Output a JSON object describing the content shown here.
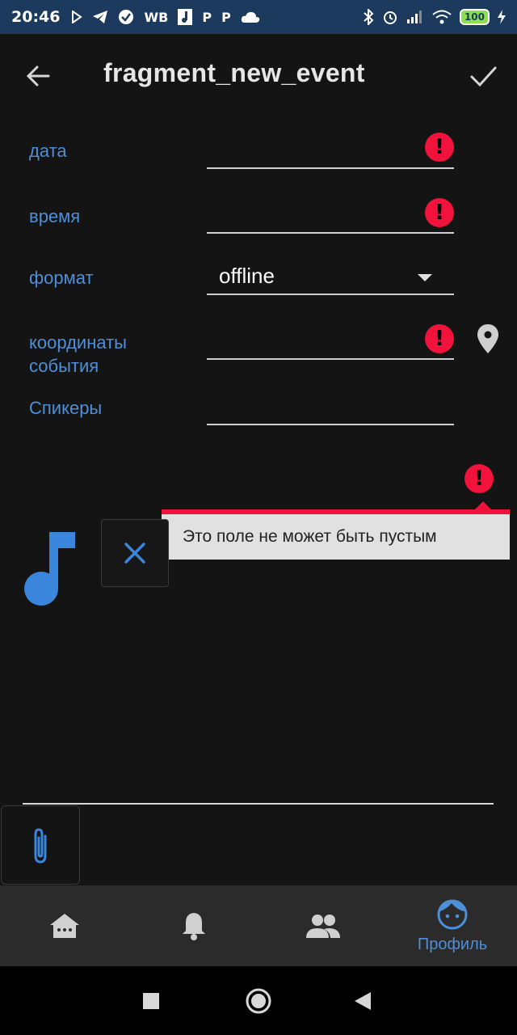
{
  "status_bar": {
    "time": "20:46",
    "icons": [
      "play-icon",
      "telegram-icon",
      "check-circle-icon",
      "WB",
      "music-note-icon",
      "P",
      "P",
      "cloud-icon"
    ],
    "wb_text": "WB",
    "p_text": "P",
    "battery": "100"
  },
  "app_bar": {
    "title": "fragment_new_event"
  },
  "form": {
    "date_label": "дата",
    "time_label": "время",
    "format_label": "формат",
    "format_value": "offline",
    "coords_label_line1": "координаты",
    "coords_label_line2": "события",
    "speakers_label": "Спикеры"
  },
  "error": {
    "icon_glyph": "!",
    "tooltip": "Это поле не может быть пустым"
  },
  "bottom_nav": {
    "items": [
      {
        "icon": "home-icon",
        "label": ""
      },
      {
        "icon": "bell-icon",
        "label": ""
      },
      {
        "icon": "people-icon",
        "label": ""
      },
      {
        "icon": "face-icon",
        "label": "Профиль"
      }
    ],
    "accent": "#4d8fd8"
  },
  "colors": {
    "accent": "#4d8fd8",
    "error": "#f2133c",
    "background": "#141414"
  }
}
